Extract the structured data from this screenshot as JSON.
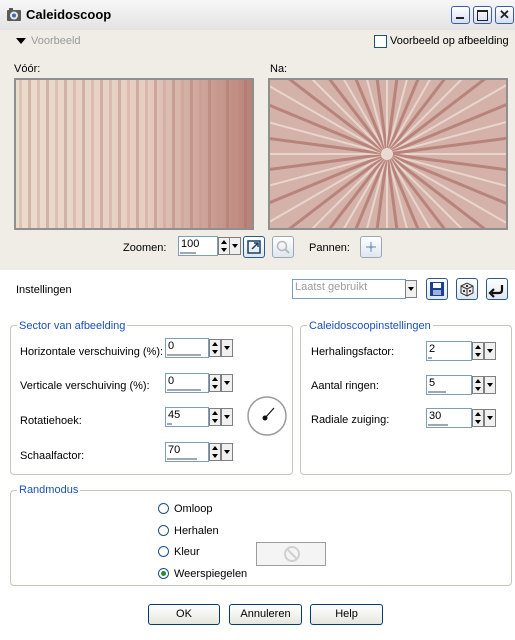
{
  "window": {
    "title": "Caleidoscoop"
  },
  "preview": {
    "toggle_label": "Voorbeeld",
    "on_image_label": "Voorbeeld op afbeelding",
    "before_label": "Vóór:",
    "after_label": "Na:"
  },
  "zoom": {
    "label": "Zoomen:",
    "value": "100"
  },
  "pan": {
    "label": "Pannen:"
  },
  "settings": {
    "label": "Instellingen",
    "preset_placeholder": "Laatst gebruikt"
  },
  "sector": {
    "title": "Sector van afbeelding",
    "fields": [
      {
        "label": "Horizontale verschuiving (%):",
        "value": "0"
      },
      {
        "label": "Verticale verschuiving (%):",
        "value": "0"
      },
      {
        "label": "Rotatiehoek:",
        "value": "45"
      },
      {
        "label": "Schaalfactor:",
        "value": "70"
      }
    ]
  },
  "kaleido": {
    "title": "Caleidoscoopinstellingen",
    "fields": [
      {
        "label": "Herhalingsfactor:",
        "value": "2"
      },
      {
        "label": "Aantal ringen:",
        "value": "5"
      },
      {
        "label": "Radiale zuiging:",
        "value": "30"
      }
    ]
  },
  "edge": {
    "title": "Randmodus",
    "options": [
      "Omloop",
      "Herhalen",
      "Kleur",
      "Weerspiegelen"
    ],
    "selected": "Weerspiegelen"
  },
  "buttons": {
    "ok": "OK",
    "cancel": "Annuleren",
    "help": "Help"
  },
  "colors": {
    "accent": "#1a50b8",
    "panel": "#efede6",
    "preview_tint": "#c79a93"
  }
}
